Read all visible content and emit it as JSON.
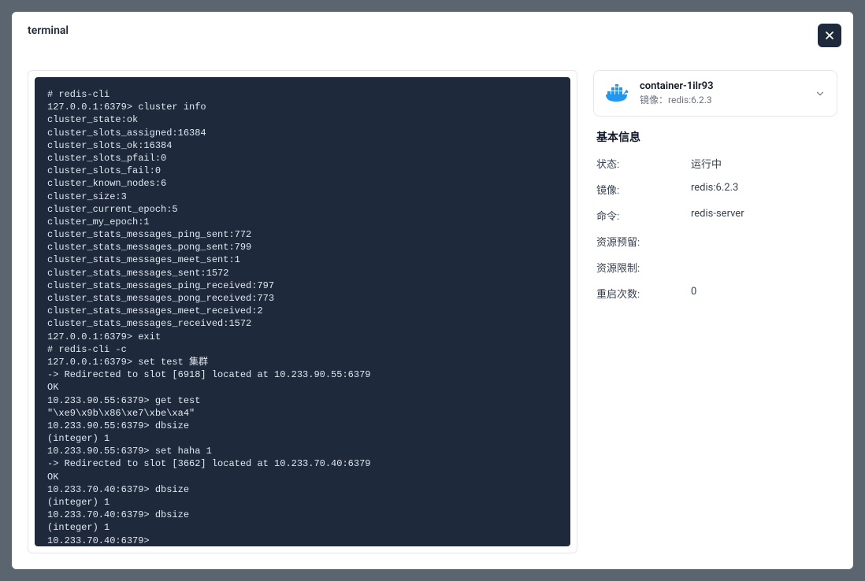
{
  "modal": {
    "title": "terminal"
  },
  "terminal": {
    "lines": [
      "# redis-cli",
      "127.0.0.1:6379> cluster info",
      "cluster_state:ok",
      "cluster_slots_assigned:16384",
      "cluster_slots_ok:16384",
      "cluster_slots_pfail:0",
      "cluster_slots_fail:0",
      "cluster_known_nodes:6",
      "cluster_size:3",
      "cluster_current_epoch:5",
      "cluster_my_epoch:1",
      "cluster_stats_messages_ping_sent:772",
      "cluster_stats_messages_pong_sent:799",
      "cluster_stats_messages_meet_sent:1",
      "cluster_stats_messages_sent:1572",
      "cluster_stats_messages_ping_received:797",
      "cluster_stats_messages_pong_received:773",
      "cluster_stats_messages_meet_received:2",
      "cluster_stats_messages_received:1572",
      "127.0.0.1:6379> exit",
      "# redis-cli -c",
      "127.0.0.1:6379> set test 集群",
      "-> Redirected to slot [6918] located at 10.233.90.55:6379",
      "OK",
      "10.233.90.55:6379> get test",
      "\"\\xe9\\x9b\\x86\\xe7\\xbe\\xa4\"",
      "10.233.90.55:6379> dbsize",
      "(integer) 1",
      "10.233.90.55:6379> set haha 1",
      "-> Redirected to slot [3662] located at 10.233.70.40:6379",
      "OK",
      "10.233.70.40:6379> dbsize",
      "(integer) 1",
      "10.233.70.40:6379> dbsize",
      "(integer) 1",
      "10.233.70.40:6379>"
    ]
  },
  "container": {
    "name": "container-1ilr93",
    "image_prefix": "镜像：",
    "image": "redis:6.2.3"
  },
  "info": {
    "section_title": "基本信息",
    "rows": [
      {
        "label": "状态:",
        "value": "运行中"
      },
      {
        "label": "镜像:",
        "value": "redis:6.2.3"
      },
      {
        "label": "命令:",
        "value": "redis-server"
      },
      {
        "label": "资源预留:",
        "value": ""
      },
      {
        "label": "资源限制:",
        "value": ""
      },
      {
        "label": "重启次数:",
        "value": "0"
      }
    ]
  }
}
